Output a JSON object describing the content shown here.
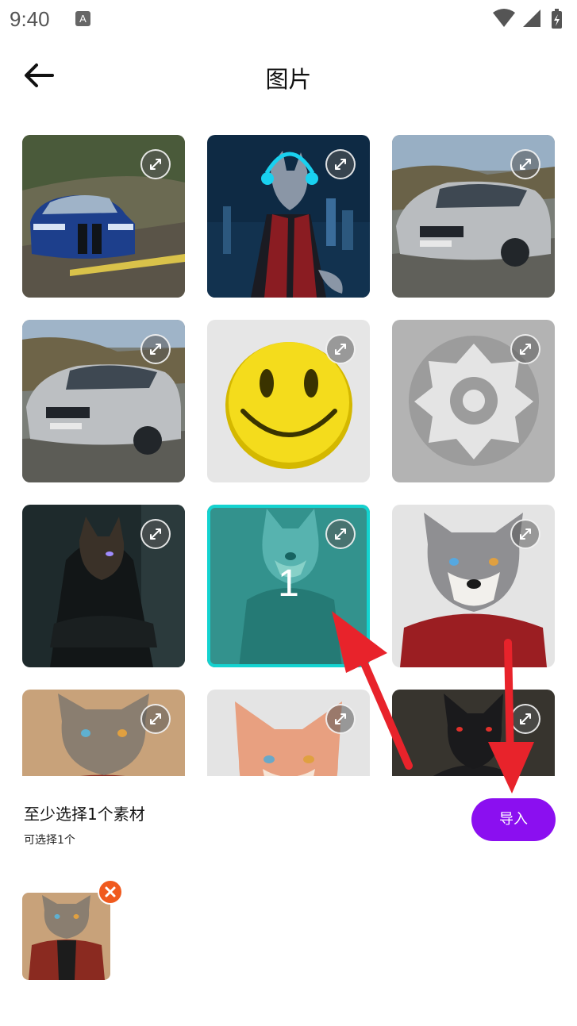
{
  "status_bar": {
    "time": "9:40",
    "notif_letter": "A"
  },
  "header": {
    "title": "图片"
  },
  "grid": {
    "tiles": [
      {
        "subject": "blue bmw car",
        "selected": false
      },
      {
        "subject": "wolf with headphones",
        "selected": false
      },
      {
        "subject": "silver bmw car",
        "selected": false
      },
      {
        "subject": "silver bmw car",
        "selected": false
      },
      {
        "subject": "yellow smiley face",
        "selected": false
      },
      {
        "subject": "gear icon",
        "selected": false
      },
      {
        "subject": "dark hooded wolf",
        "selected": false
      },
      {
        "subject": "wolf in hoodie",
        "selected": true,
        "selection_number": "1"
      },
      {
        "subject": "grey wolf red hoodie",
        "selected": false
      },
      {
        "subject": "wolf red jacket",
        "selected": false
      },
      {
        "subject": "orange fox",
        "selected": false
      },
      {
        "subject": "black wolf dark",
        "selected": false
      }
    ]
  },
  "bottom": {
    "requirement": "至少选择1个素材",
    "sub": "可选择1个",
    "import_label": "导入"
  },
  "colors": {
    "accent": "#8b0ff0",
    "selection": "#14d3d0",
    "remove": "#f05a1e",
    "arrow": "#e8232b"
  },
  "icons": [
    "back-arrow-icon",
    "expand-icon",
    "close-icon",
    "wifi-icon",
    "signal-icon",
    "battery-icon"
  ]
}
